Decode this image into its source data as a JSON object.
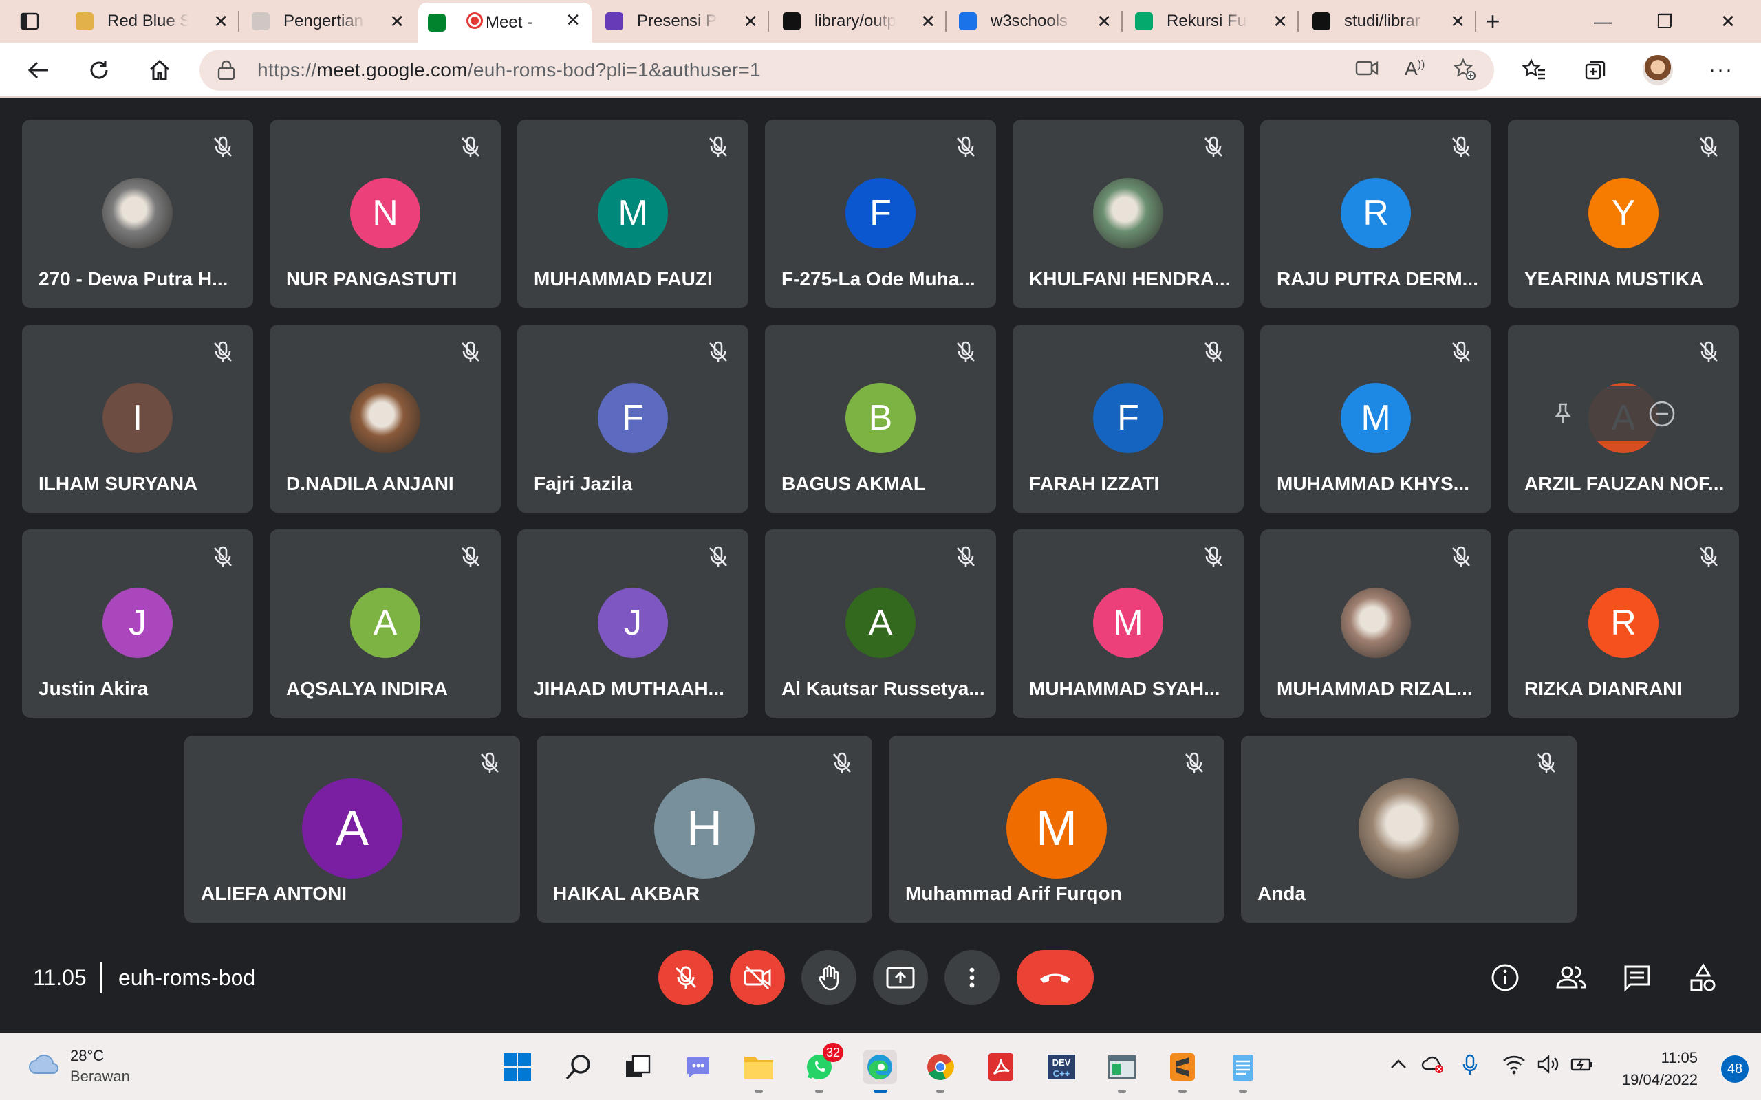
{
  "browser": {
    "tabs": [
      {
        "label": "Red Blue Sc",
        "favicon": "document-icon",
        "color": "#e3b14a"
      },
      {
        "label": "Pengertian",
        "favicon": "generic-page-icon",
        "color": "#cfc7c4"
      },
      {
        "label": "Meet -",
        "favicon": "meet-icon",
        "color": "#00832d",
        "active": true
      },
      {
        "label": "Presensi Pra",
        "favicon": "forms-icon",
        "color": "#673ab7"
      },
      {
        "label": "library/outp",
        "favicon": "github-icon",
        "color": "#111111"
      },
      {
        "label": "w3schools",
        "favicon": "bing-icon",
        "color": "#1a73e8"
      },
      {
        "label": "Rekursi Fun",
        "favicon": "w3-icon",
        "color": "#04aa6d"
      },
      {
        "label": "studi/librar",
        "favicon": "github-icon",
        "color": "#111111"
      }
    ],
    "url_prefix": "https://",
    "url_host": "meet.google.com",
    "url_path": "/euh-roms-bod?pli=1&authuser=1"
  },
  "participants_row1": [
    {
      "name": "270 - Dewa Putra H...",
      "initial": "",
      "color": "#7b7b7b",
      "photo": true
    },
    {
      "name": "NUR PANGASTUTI",
      "initial": "N",
      "color": "#ec407a"
    },
    {
      "name": "MUHAMMAD FAUZI",
      "initial": "M",
      "color": "#00897b"
    },
    {
      "name": "F-275-La Ode Muha...",
      "initial": "F",
      "color": "#0b57d0"
    },
    {
      "name": "KHULFANI HENDRA...",
      "initial": "",
      "color": "#6b8f71",
      "photo": true
    },
    {
      "name": "RAJU PUTRA DERM...",
      "initial": "R",
      "color": "#1e88e5"
    },
    {
      "name": "YEARINA MUSTIKA",
      "initial": "Y",
      "color": "#f57c00"
    }
  ],
  "participants_row2": [
    {
      "name": "ILHAM SURYANA",
      "initial": "I",
      "color": "#6d4c41"
    },
    {
      "name": "D.NADILA ANJANI",
      "initial": "",
      "color": "#8a5a3a",
      "photo": true
    },
    {
      "name": "Fajri Jazila",
      "initial": "F",
      "color": "#5c6bc0"
    },
    {
      "name": "BAGUS AKMAL",
      "initial": "B",
      "color": "#7cb342"
    },
    {
      "name": "FARAH IZZATI",
      "initial": "F",
      "color": "#1565c0"
    },
    {
      "name": "MUHAMMAD KHYS...",
      "initial": "M",
      "color": "#1e88e5"
    },
    {
      "name": "ARZIL FAUZAN NOF...",
      "initial": "A",
      "color": "#f4511e",
      "hover": true
    }
  ],
  "participants_row3": [
    {
      "name": "Justin Akira",
      "initial": "J",
      "color": "#ab47bc"
    },
    {
      "name": "AQSALYA INDIRA",
      "initial": "A",
      "color": "#7cb342"
    },
    {
      "name": "JIHAAD MUTHAAH...",
      "initial": "J",
      "color": "#7e57c2"
    },
    {
      "name": "Al Kautsar Russetya...",
      "initial": "A",
      "color": "#33691e"
    },
    {
      "name": "MUHAMMAD SYAH...",
      "initial": "M",
      "color": "#ec407a"
    },
    {
      "name": "MUHAMMAD RIZAL...",
      "initial": "",
      "color": "#a08070",
      "photo": true
    },
    {
      "name": "RIZKA DIANRANI",
      "initial": "R",
      "color": "#f4511e"
    }
  ],
  "participants_row4": [
    {
      "name": "ALIEFA ANTONI",
      "initial": "A",
      "color": "#7b1fa2"
    },
    {
      "name": "HAIKAL AKBAR",
      "initial": "H",
      "color": "#78909c"
    },
    {
      "name": "Muhammad Arif Furqon",
      "initial": "M",
      "color": "#ef6c00"
    },
    {
      "name": "Anda",
      "initial": "",
      "color": "#9a8470",
      "photo": true
    }
  ],
  "meeting": {
    "time": "11.05",
    "code": "euh-roms-bod",
    "participant_count": "25"
  },
  "taskbar": {
    "temperature": "28°C",
    "weather": "Berawan",
    "whatsapp_badge": "32",
    "time": "11:05",
    "date": "19/04/2022",
    "notifications": "48"
  }
}
